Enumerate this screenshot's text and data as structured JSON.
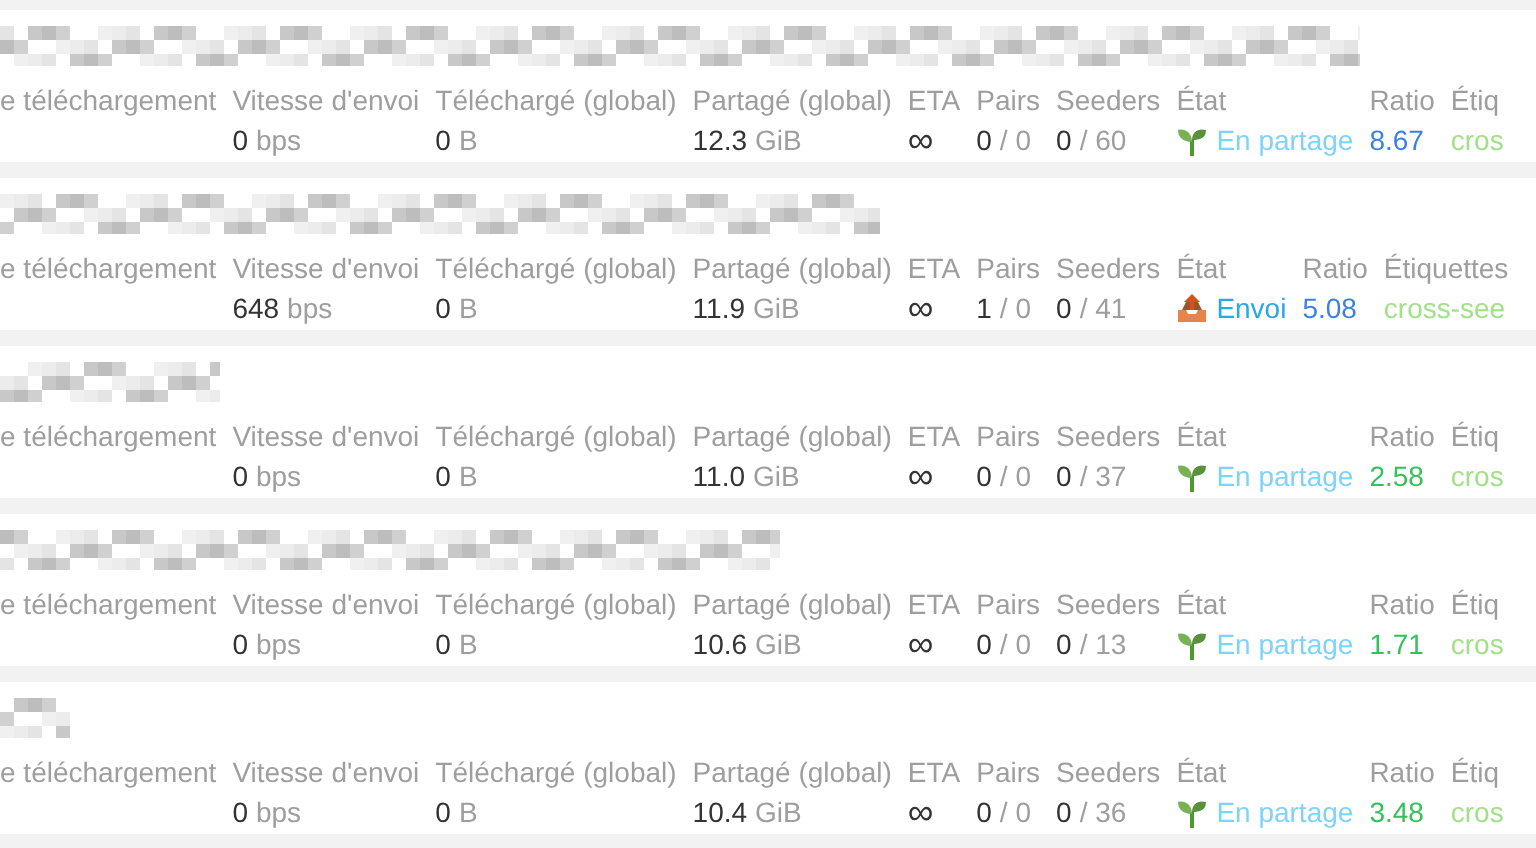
{
  "torrents": [
    {
      "labels": {
        "download_speed": "e téléchargement",
        "upload_speed": "Vitesse d'envoi",
        "downloaded": "Téléchargé (global)",
        "uploaded": "Partagé (global)",
        "eta": "ETA",
        "peers": "Pairs",
        "seeders": "Seeders",
        "state": "État",
        "ratio": "Ratio",
        "tags": "Étiq"
      },
      "upload_speed": {
        "value": "0",
        "unit": "bps"
      },
      "downloaded": {
        "value": "0",
        "unit": "B"
      },
      "uploaded": {
        "value": "12.3",
        "unit": "GiB"
      },
      "eta": "∞",
      "peers": {
        "active": "0",
        "total": "/ 0"
      },
      "seeders": {
        "active": "0",
        "total": "/ 60"
      },
      "state": {
        "kind": "seeding",
        "label": "En partage"
      },
      "ratio": {
        "value": "8.67",
        "color": "#3b82e0"
      },
      "tags": "cros"
    },
    {
      "labels": {
        "download_speed": "e téléchargement",
        "upload_speed": "Vitesse d'envoi",
        "downloaded": "Téléchargé (global)",
        "uploaded": "Partagé (global)",
        "eta": "ETA",
        "peers": "Pairs",
        "seeders": "Seeders",
        "state": "État",
        "ratio": "Ratio",
        "tags": "Étiquettes"
      },
      "upload_speed": {
        "value": "648",
        "unit": "bps"
      },
      "downloaded": {
        "value": "0",
        "unit": "B"
      },
      "uploaded": {
        "value": "11.9",
        "unit": "GiB"
      },
      "eta": "∞",
      "peers": {
        "active": "1",
        "total": "/ 0"
      },
      "seeders": {
        "active": "0",
        "total": "/ 41"
      },
      "state": {
        "kind": "uploading",
        "label": "Envoi"
      },
      "ratio": {
        "value": "5.08",
        "color": "#3b82e0"
      },
      "tags": "cross-see"
    },
    {
      "labels": {
        "download_speed": "e téléchargement",
        "upload_speed": "Vitesse d'envoi",
        "downloaded": "Téléchargé (global)",
        "uploaded": "Partagé (global)",
        "eta": "ETA",
        "peers": "Pairs",
        "seeders": "Seeders",
        "state": "État",
        "ratio": "Ratio",
        "tags": "Étiq"
      },
      "upload_speed": {
        "value": "0",
        "unit": "bps"
      },
      "downloaded": {
        "value": "0",
        "unit": "B"
      },
      "uploaded": {
        "value": "11.0",
        "unit": "GiB"
      },
      "eta": "∞",
      "peers": {
        "active": "0",
        "total": "/ 0"
      },
      "seeders": {
        "active": "0",
        "total": "/ 37"
      },
      "state": {
        "kind": "seeding",
        "label": "En partage"
      },
      "ratio": {
        "value": "2.58",
        "color": "#34c05a"
      },
      "tags": "cros"
    },
    {
      "labels": {
        "download_speed": "e téléchargement",
        "upload_speed": "Vitesse d'envoi",
        "downloaded": "Téléchargé (global)",
        "uploaded": "Partagé (global)",
        "eta": "ETA",
        "peers": "Pairs",
        "seeders": "Seeders",
        "state": "État",
        "ratio": "Ratio",
        "tags": "Étiq"
      },
      "upload_speed": {
        "value": "0",
        "unit": "bps"
      },
      "downloaded": {
        "value": "0",
        "unit": "B"
      },
      "uploaded": {
        "value": "10.6",
        "unit": "GiB"
      },
      "eta": "∞",
      "peers": {
        "active": "0",
        "total": "/ 0"
      },
      "seeders": {
        "active": "0",
        "total": "/ 13"
      },
      "state": {
        "kind": "seeding",
        "label": "En partage"
      },
      "ratio": {
        "value": "1.71",
        "color": "#34c05a"
      },
      "tags": "cros"
    },
    {
      "labels": {
        "download_speed": "e téléchargement",
        "upload_speed": "Vitesse d'envoi",
        "downloaded": "Téléchargé (global)",
        "uploaded": "Partagé (global)",
        "eta": "ETA",
        "peers": "Pairs",
        "seeders": "Seeders",
        "state": "État",
        "ratio": "Ratio",
        "tags": "Étiq"
      },
      "upload_speed": {
        "value": "0",
        "unit": "bps"
      },
      "downloaded": {
        "value": "0",
        "unit": "B"
      },
      "uploaded": {
        "value": "10.4",
        "unit": "GiB"
      },
      "eta": "∞",
      "peers": {
        "active": "0",
        "total": "/ 0"
      },
      "seeders": {
        "active": "0",
        "total": "/ 36"
      },
      "state": {
        "kind": "seeding",
        "label": "En partage"
      },
      "ratio": {
        "value": "3.48",
        "color": "#34c05a"
      },
      "tags": "cros"
    }
  ]
}
